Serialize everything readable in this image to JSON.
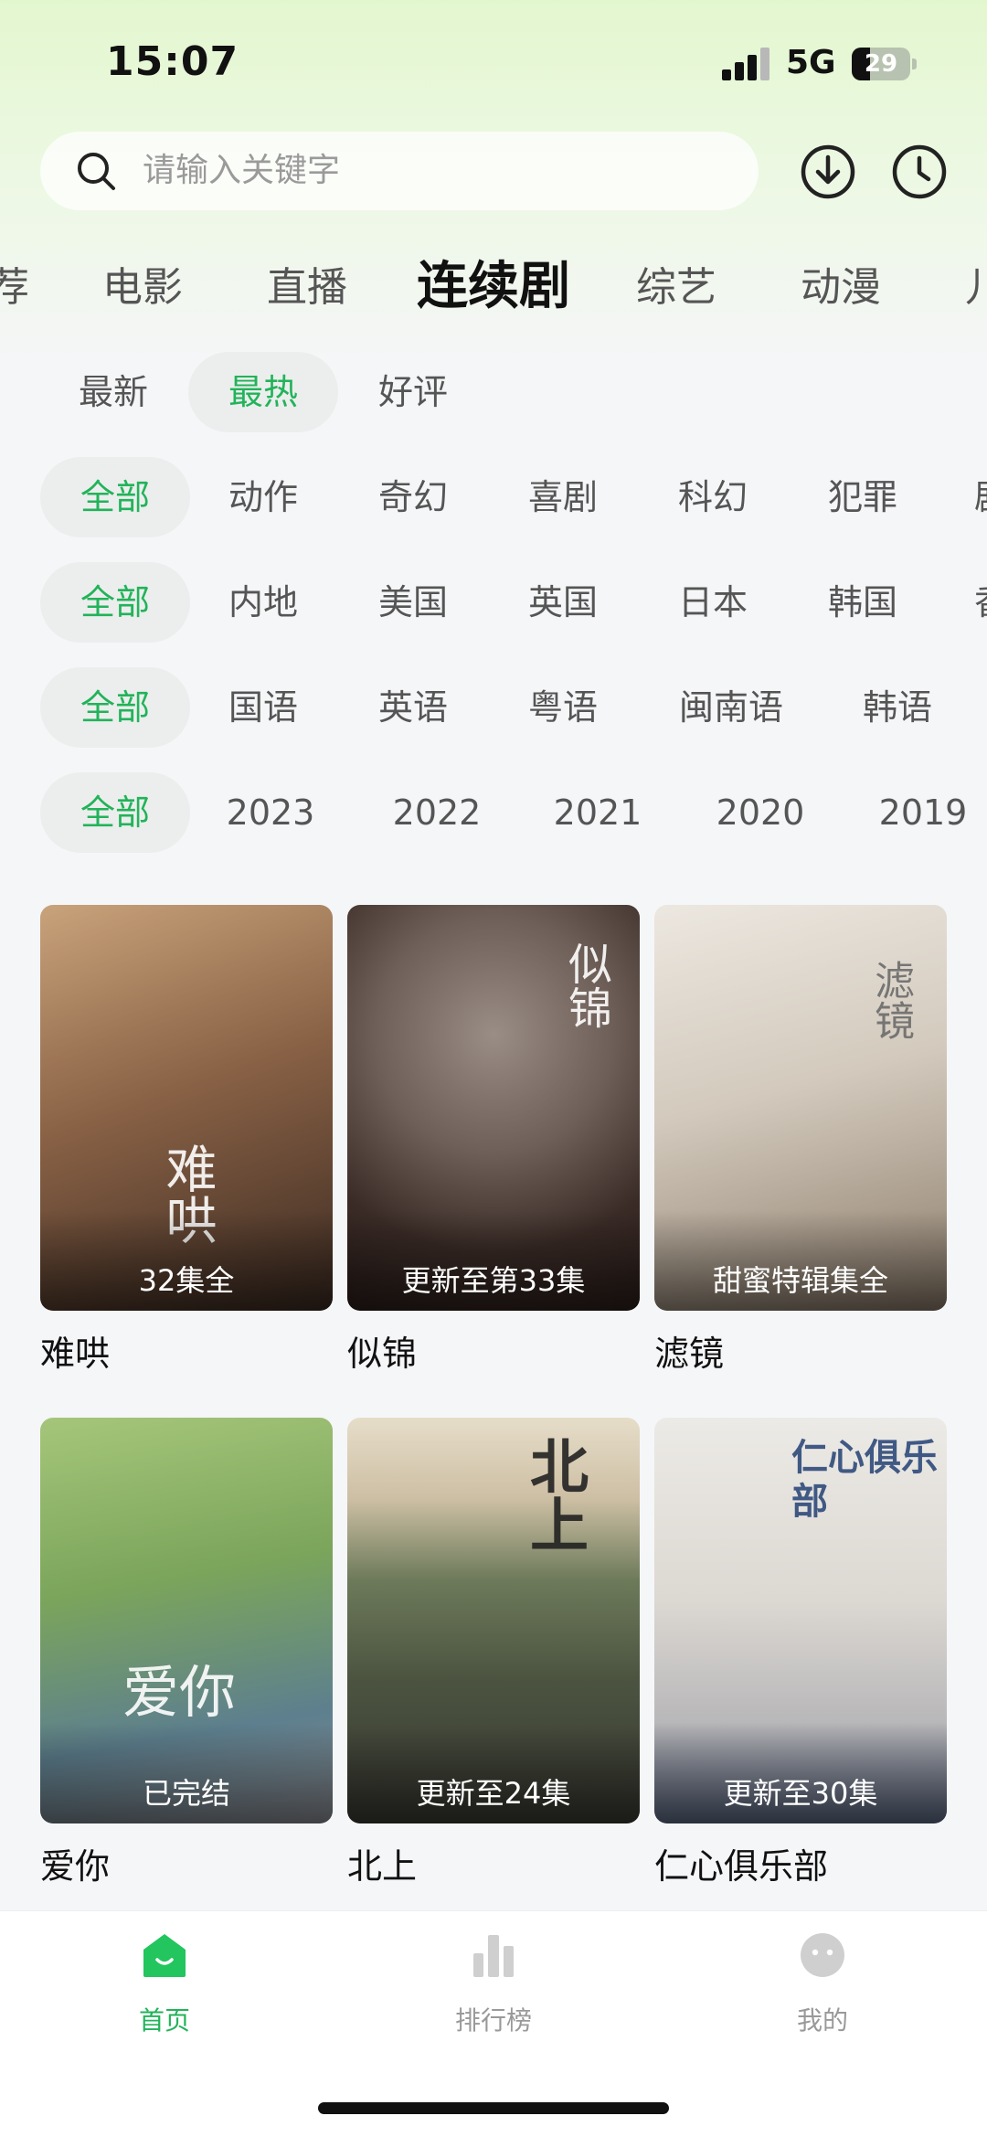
{
  "status_bar": {
    "time": "15:07",
    "network": "5G",
    "battery": "29"
  },
  "search": {
    "placeholder": "请输入关键字"
  },
  "header_icons": {
    "download": "download-icon",
    "history": "clock-icon"
  },
  "main_tabs": [
    {
      "label": "荐"
    },
    {
      "label": "电影"
    },
    {
      "label": "直播"
    },
    {
      "label": "连续剧",
      "active": true
    },
    {
      "label": "综艺"
    },
    {
      "label": "动漫"
    },
    {
      "label": "儿"
    }
  ],
  "sort_row": [
    "最新",
    "最热",
    "好评"
  ],
  "genre_row": [
    "全部",
    "动作",
    "奇幻",
    "喜剧",
    "科幻",
    "犯罪",
    "剧"
  ],
  "region_row": [
    "全部",
    "内地",
    "美国",
    "英国",
    "日本",
    "韩国",
    "香"
  ],
  "language_row": [
    "全部",
    "国语",
    "英语",
    "粤语",
    "闽南语",
    "韩语"
  ],
  "year_row": [
    "全部",
    "2023",
    "2022",
    "2021",
    "2020",
    "2019"
  ],
  "shows": [
    {
      "title": "难哄",
      "badge": "32集全",
      "poster_text": "难哄"
    },
    {
      "title": "似锦",
      "badge": "更新至第33集",
      "poster_text": "似锦"
    },
    {
      "title": "滤镜",
      "badge": "甜蜜特辑集全",
      "poster_text": "滤镜"
    },
    {
      "title": "爱你",
      "badge": "已完结",
      "poster_text": "爱你"
    },
    {
      "title": "北上",
      "badge": "更新至24集",
      "poster_text": "北上"
    },
    {
      "title": "仁心俱乐部",
      "badge": "更新至30集",
      "poster_text": "仁心俱乐部"
    }
  ],
  "bottom_nav": [
    {
      "label": "首页",
      "active": true
    },
    {
      "label": "排行榜"
    },
    {
      "label": "我的"
    }
  ],
  "colors": {
    "accent": "#22b35a",
    "chip_bg": "#eceeed"
  }
}
